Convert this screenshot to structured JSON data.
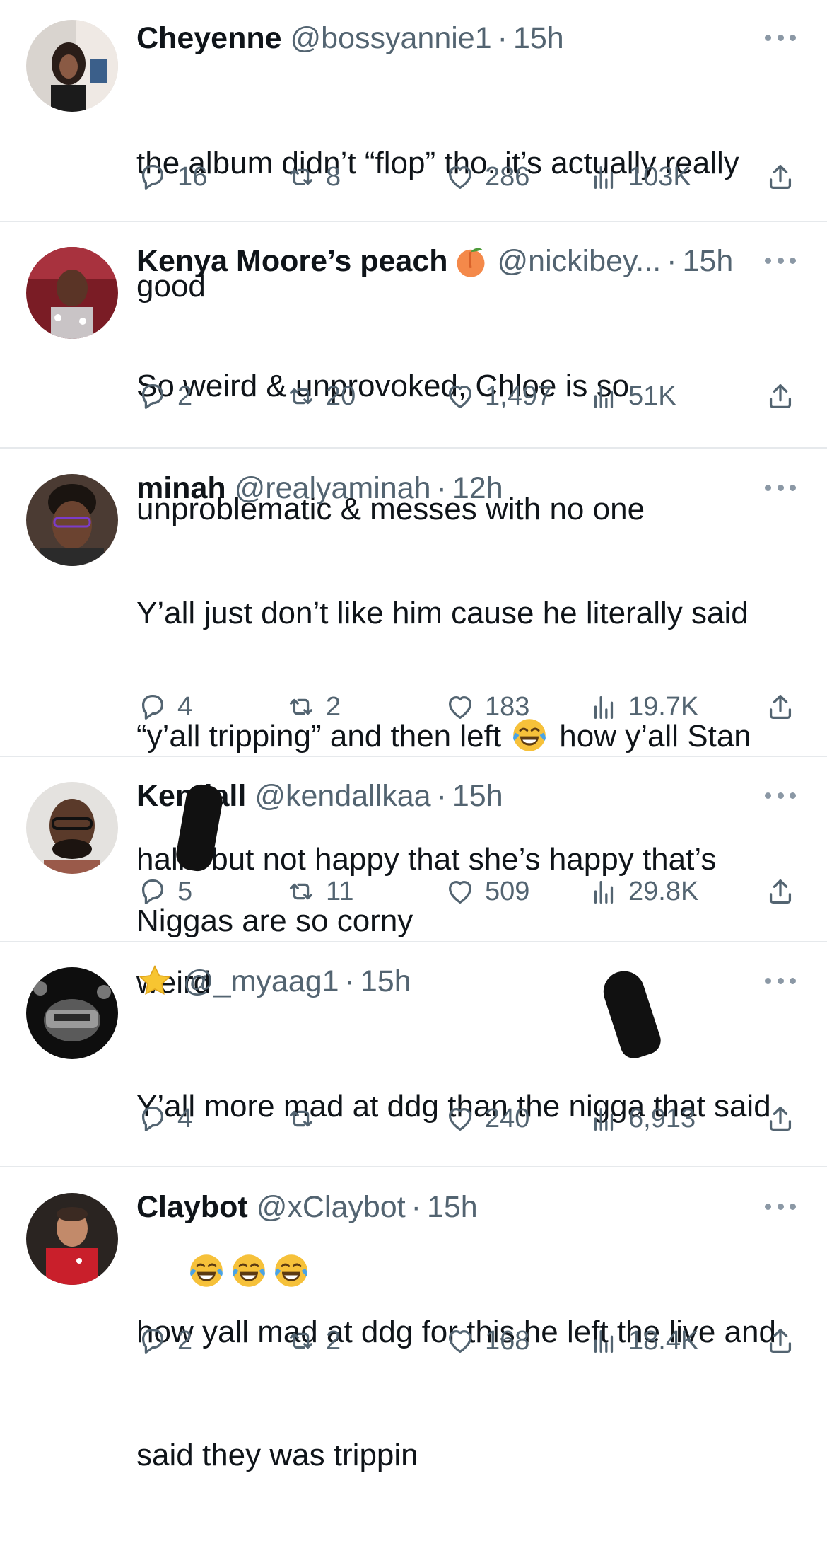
{
  "tweets": [
    {
      "name": "Cheyenne",
      "handle": "@bossyannie1",
      "time": "15h",
      "lines": [
        "the album didn’t “flop” tho. it’s actually really",
        "good"
      ],
      "replies": "16",
      "retweets": "8",
      "likes": "286",
      "views": "103K"
    },
    {
      "name": "Kenya Moore’s peach",
      "handle": "@nickibey...",
      "time": "15h",
      "lines": [
        "So weird & unprovoked, Chloe is so",
        "unproblematic & messes with no one"
      ],
      "replies": "2",
      "retweets": "20",
      "likes": "1,497",
      "views": "51K"
    },
    {
      "name": "minah",
      "handle": "@realyaminah",
      "time": "12h",
      "lines": [
        "Y’all just don’t like him cause he literally said",
        "“y’all tripping” and then left",
        " how y’all Stan",
        "halle but not happy that she’s happy that’s",
        "weird"
      ],
      "replies": "4",
      "retweets": "2",
      "likes": "183",
      "views": "19.7K"
    },
    {
      "name": "Kendall",
      "handle": "@kendallkaa",
      "time": "15h",
      "lines": [
        "Niggas are so corny"
      ],
      "replies": "5",
      "retweets": "11",
      "likes": "509",
      "views": "29.8K"
    },
    {
      "name": "",
      "handle": "@_myaag1",
      "time": "15h",
      "lines": [
        "Y’all more mad at ddg than the nigga that said"
      ],
      "replies": "4",
      "retweets": "",
      "likes": "240",
      "views": "6,913"
    },
    {
      "name": "Claybot",
      "handle": "@xClaybot",
      "time": "15h",
      "lines": [
        "how yall mad at ddg for this he left the live and",
        "said they was trippin"
      ],
      "replies": "2",
      "retweets": "2",
      "likes": "168",
      "views": "18.4K"
    }
  ],
  "icons": {
    "reply": "reply-icon",
    "retweet": "retweet-icon",
    "like": "heart-icon",
    "views": "views-icon",
    "share": "share-icon",
    "more": "more-icon"
  },
  "colors": {
    "text": "#0f1419",
    "muted": "#536471",
    "divider": "#e6e9ec"
  }
}
